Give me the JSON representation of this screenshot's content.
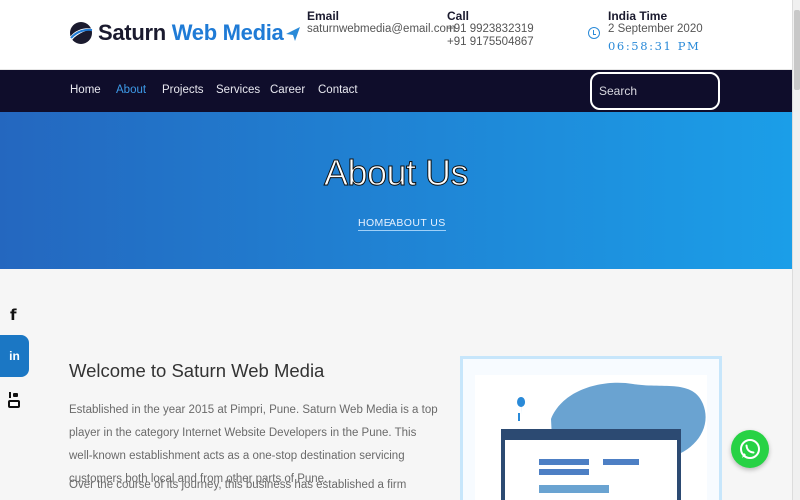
{
  "header": {
    "logo": {
      "word1": "Saturn",
      "word2": "Web Media"
    },
    "email": {
      "label": "Email",
      "value": "saturnwebmedia@email.com"
    },
    "call": {
      "label": "Call",
      "phone1": "+91 9923832319",
      "phone2": "+91 9175504867"
    },
    "time": {
      "label": "India Time",
      "date": "2 September 2020",
      "clock": "06:58:31 PM"
    }
  },
  "nav": {
    "items": [
      {
        "label": "Home"
      },
      {
        "label": "About"
      },
      {
        "label": "Projects"
      },
      {
        "label": "Services"
      },
      {
        "label": "Career"
      },
      {
        "label": "Contact"
      }
    ],
    "active_item": "About",
    "search_placeholder": "Search"
  },
  "hero": {
    "title": "About Us",
    "breadcrumb": [
      "HOME",
      "ABOUT US"
    ]
  },
  "social": {
    "facebook_glyph": "f",
    "linkedin_glyph": "in"
  },
  "main": {
    "heading": "Welcome to Saturn Web Media",
    "paragraph1": "Established in the year 2015 at Pimpri, Pune. Saturn Web Media is a top player in the category Internet Website Developers in the Pune. This well-known establishment acts as a one-stop destination servicing customers both local and from other parts of Pune.",
    "paragraph2": "Over the course of its journey, this business has established a firm foothold in its"
  },
  "colors": {
    "nav_bg": "#0f0d2b",
    "accent": "#1f7bd6",
    "hero_gradient_start": "#2467bf",
    "hero_gradient_end": "#1b9ee8",
    "whatsapp": "#27d245"
  },
  "icons": [
    "logo-mark-icon",
    "send-icon",
    "clock-icon",
    "facebook-icon",
    "linkedin-icon",
    "youtube-icon",
    "whatsapp-icon"
  ]
}
